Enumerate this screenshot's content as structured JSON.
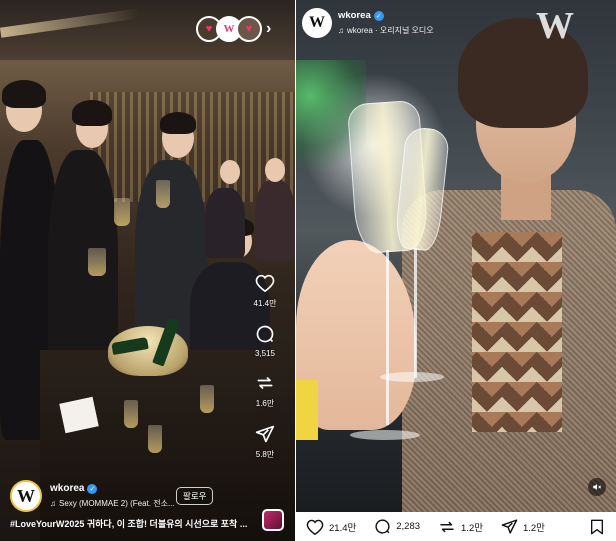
{
  "left_reel": {
    "header": {
      "stories_count_label": "",
      "chevron": "chevron-right-icon"
    },
    "actions": {
      "like_count": "41.4만",
      "comment_count": "3,515",
      "repost_count": "1.6만",
      "share_count": "5.8만"
    },
    "author": {
      "username": "wkorea",
      "logo_letter": "W",
      "audio": "Sexy (MOMMAE 2) (Feat. 전소...",
      "follow_label": "팔로우"
    },
    "caption": "#LoveYourW2025 귀하다, 이 조합! 더블유의 시선으로 포착 ..."
  },
  "right_story": {
    "author": {
      "username": "wkorea",
      "logo_letter": "W",
      "audio": "wkorea · 오리지널 오디오"
    },
    "brand_mark": "W",
    "actions": {
      "like_count": "21.4만",
      "comment_count": "2,283",
      "repost_count": "1.2만",
      "share_count": "1.2만"
    }
  },
  "colors": {
    "verified": "#3897f0",
    "heart": "#e53b6f"
  }
}
